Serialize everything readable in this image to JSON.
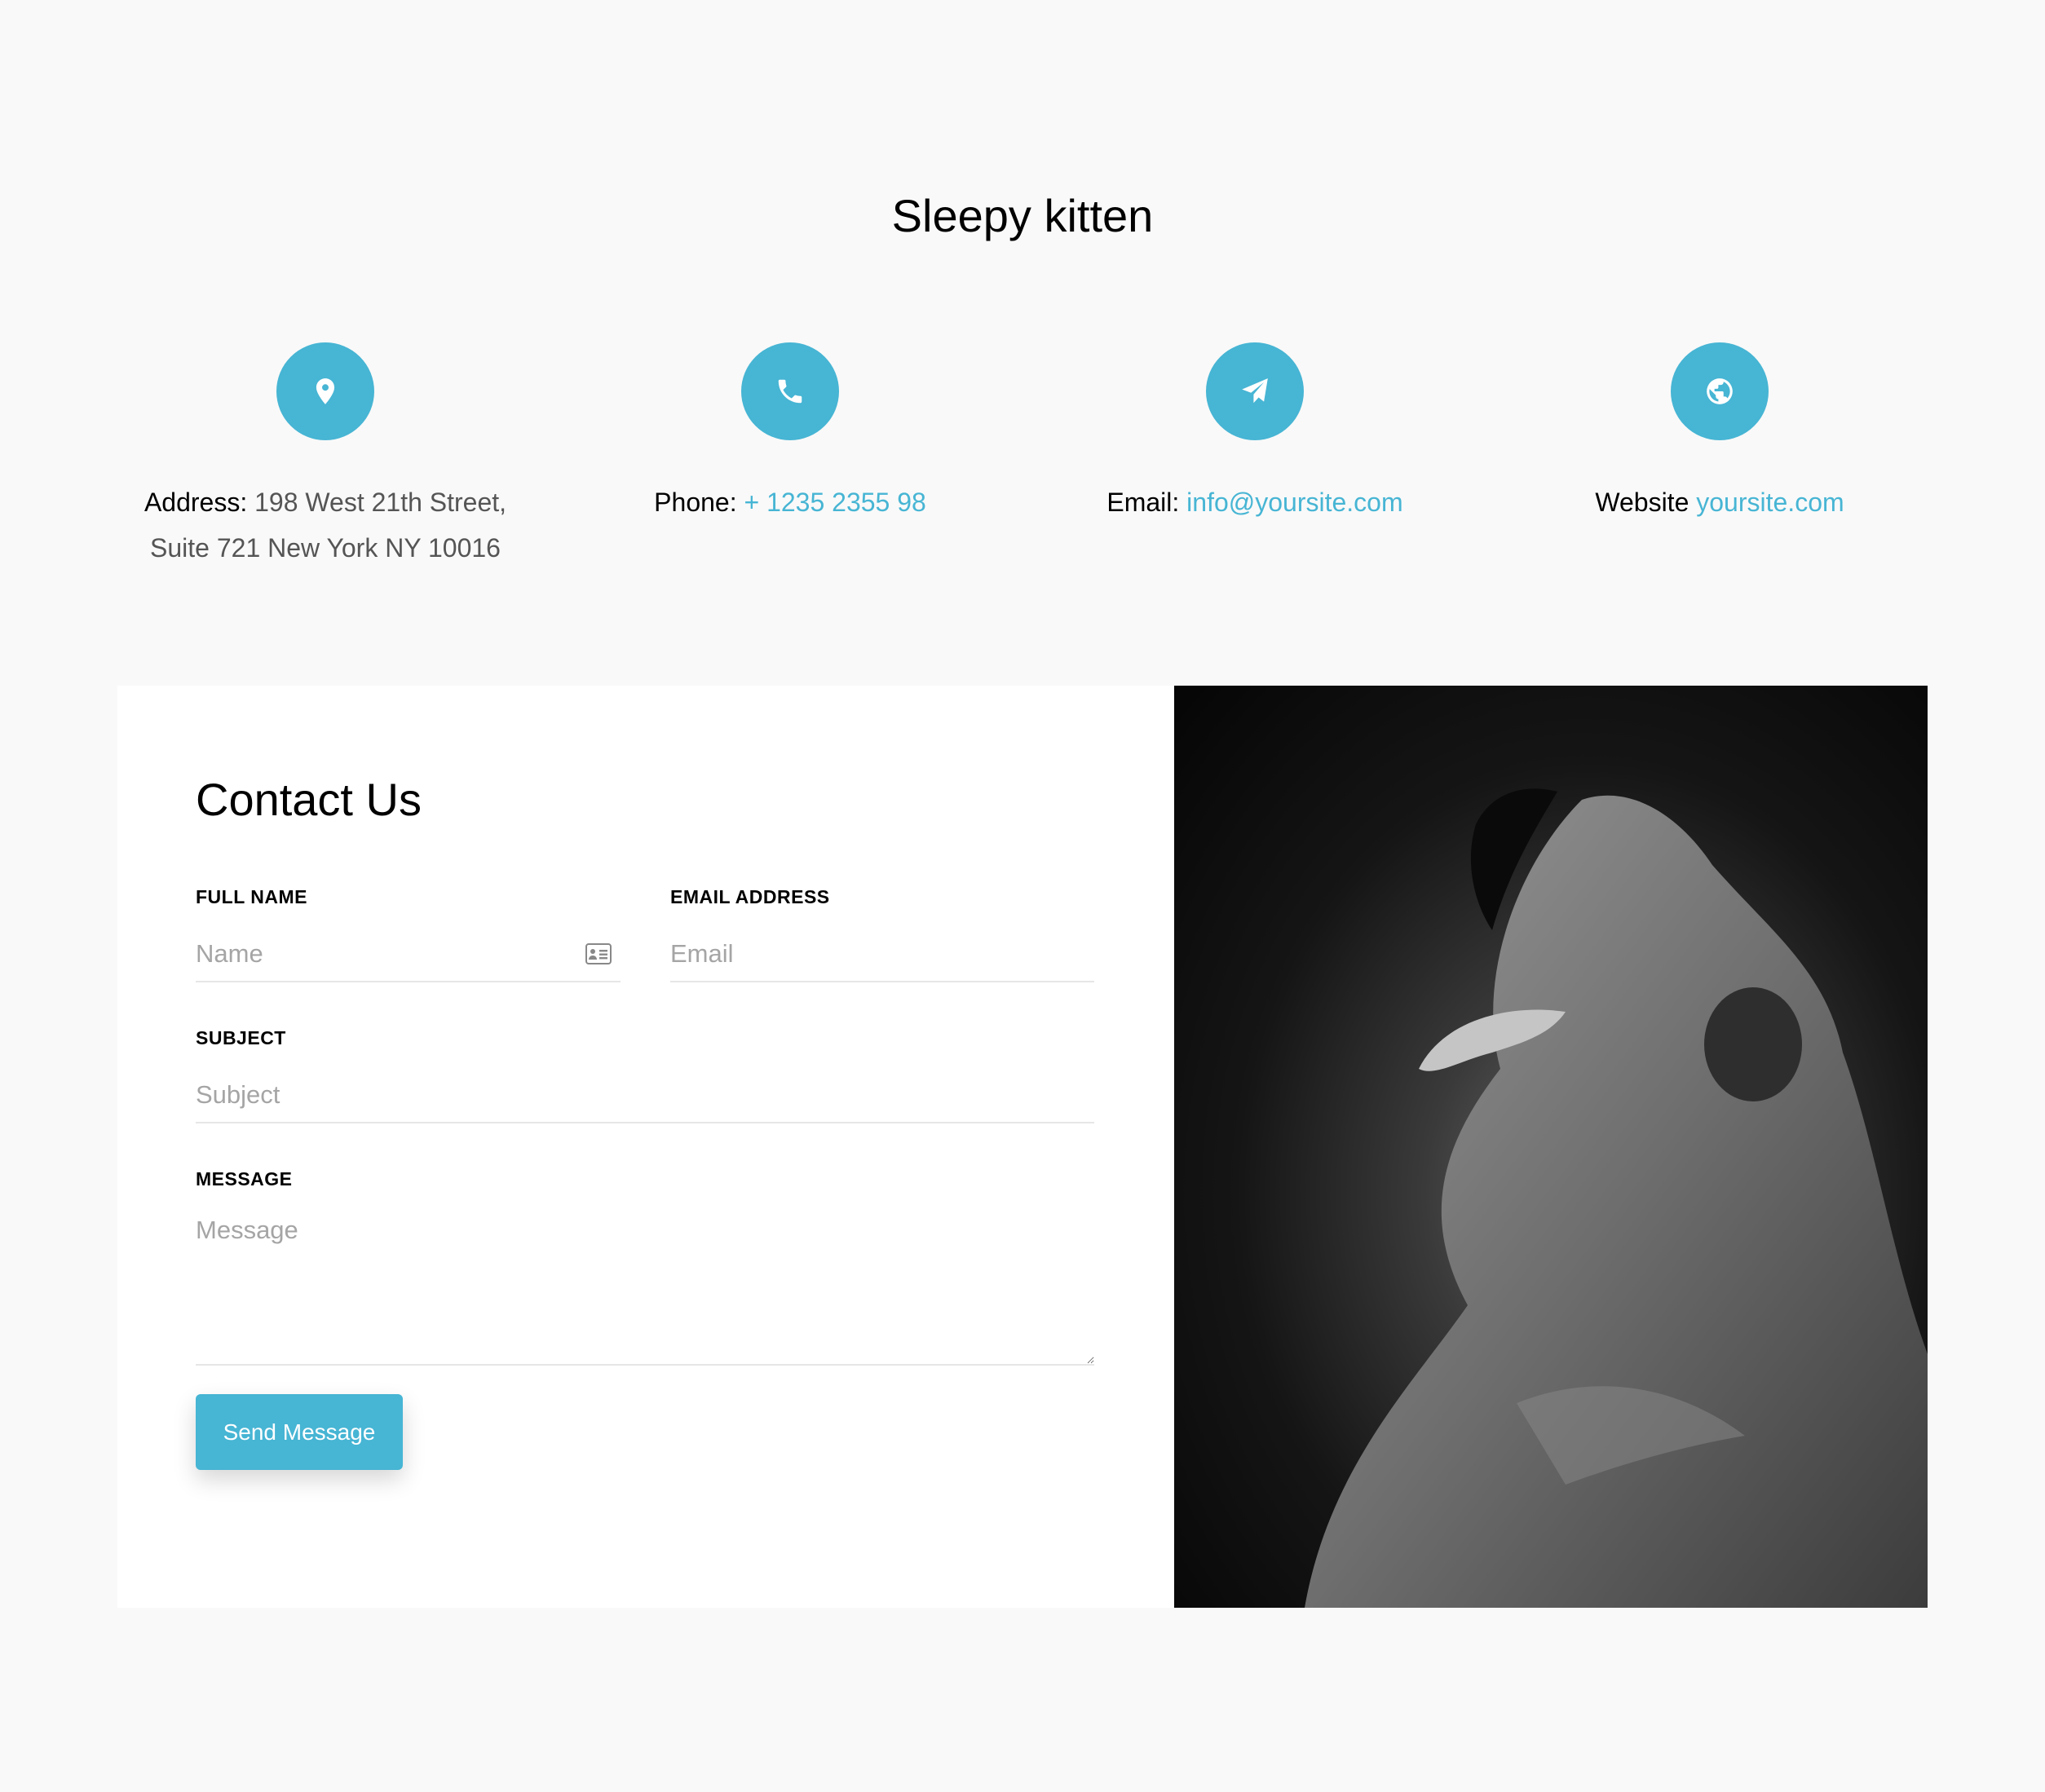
{
  "page": {
    "title": "Sleepy kitten"
  },
  "info": {
    "address": {
      "label": "Address:",
      "line1": "198 West 21th Street,",
      "line2": "Suite 721 New York NY 10016",
      "icon": "map-pin-icon"
    },
    "phone": {
      "label": "Phone:",
      "value": "+ 1235 2355 98",
      "icon": "phone-icon"
    },
    "email": {
      "label": "Email:",
      "value": "info@yoursite.com",
      "icon": "paper-plane-icon"
    },
    "website": {
      "label": "Website",
      "value": "yoursite.com",
      "icon": "globe-icon"
    }
  },
  "form": {
    "title": "Contact Us",
    "full_name": {
      "label": "FULL NAME",
      "placeholder": "Name",
      "icon": "contact-card-icon"
    },
    "email": {
      "label": "EMAIL ADDRESS",
      "placeholder": "Email"
    },
    "subject": {
      "label": "SUBJECT",
      "placeholder": "Subject"
    },
    "message": {
      "label": "MESSAGE",
      "placeholder": "Message"
    },
    "submit_label": "Send Message"
  },
  "colors": {
    "accent": "#47b5d4",
    "background": "#f9f9f9",
    "card": "#ffffff"
  }
}
